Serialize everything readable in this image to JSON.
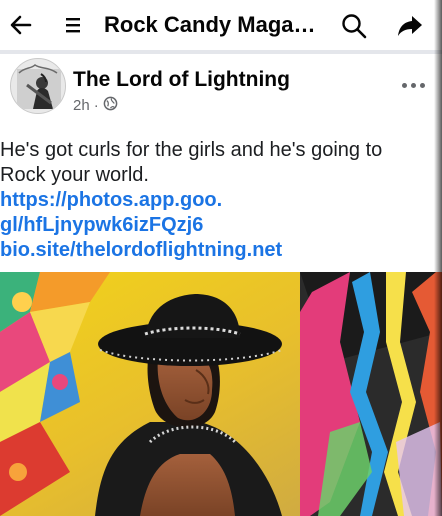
{
  "topbar": {
    "back_icon": "arrow-left-icon",
    "menu_icon": "hamburger-menu-icon",
    "title": "Rock Candy Magazin...",
    "search_icon": "search-icon",
    "share_icon": "share-arrow-icon"
  },
  "post": {
    "author": "The Lord of Lightning",
    "time": "2h",
    "separator": "·",
    "privacy_icon": "globe-icon",
    "more_icon": "more-options-icon",
    "text_line1": "He's got curls for the girls and he's going to",
    "text_line2": "Rock your world.",
    "link1_line1": "https://photos.app.goo.",
    "link1_line2": "gl/hfLjnypwk6izFQzj6",
    "link2": "bio.site/thelordoflightning.net"
  },
  "colors": {
    "link": "#1b74e4",
    "meta": "#65676b",
    "divider": "#e4e6eb"
  }
}
